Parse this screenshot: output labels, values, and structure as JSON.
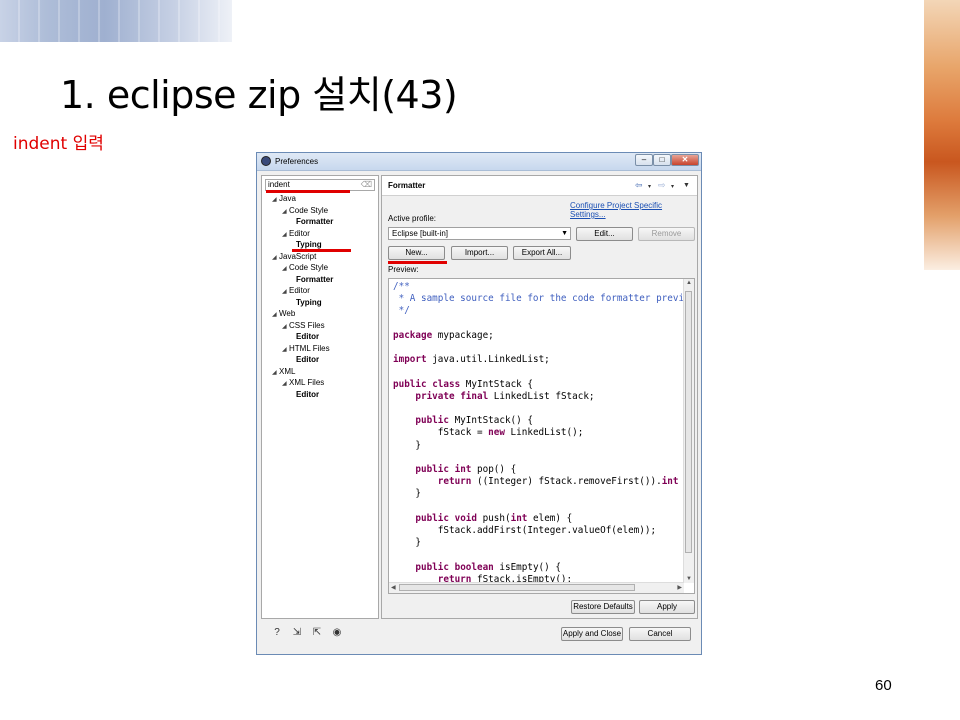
{
  "slide": {
    "title": "1. eclipse zip 설치(43)",
    "subtitle": "indent 입력",
    "page_number": "60"
  },
  "dialog": {
    "title": "Preferences",
    "filter_value": "indent",
    "tree": [
      {
        "label": "Java",
        "level": 0,
        "expanded": true
      },
      {
        "label": "Code Style",
        "level": 1,
        "expanded": true
      },
      {
        "label": "Formatter",
        "level": 2
      },
      {
        "label": "Editor",
        "level": 1,
        "expanded": true
      },
      {
        "label": "Typing",
        "level": 2
      },
      {
        "label": "JavaScript",
        "level": 0,
        "expanded": true
      },
      {
        "label": "Code Style",
        "level": 1,
        "expanded": true
      },
      {
        "label": "Formatter",
        "level": 2
      },
      {
        "label": "Editor",
        "level": 1,
        "expanded": true
      },
      {
        "label": "Typing",
        "level": 2
      },
      {
        "label": "Web",
        "level": 0,
        "expanded": true
      },
      {
        "label": "CSS Files",
        "level": 1,
        "expanded": true
      },
      {
        "label": "Editor",
        "level": 2
      },
      {
        "label": "HTML Files",
        "level": 1,
        "expanded": true
      },
      {
        "label": "Editor",
        "level": 2
      },
      {
        "label": "XML",
        "level": 0,
        "expanded": true
      },
      {
        "label": "XML Files",
        "level": 1,
        "expanded": true
      },
      {
        "label": "Editor",
        "level": 2
      }
    ],
    "page_heading": "Formatter",
    "configure_link": "Configure Project Specific Settings...",
    "active_profile_label": "Active profile:",
    "profile_value": "Eclipse [built-in]",
    "buttons": {
      "edit": "Edit...",
      "remove": "Remove",
      "new": "New...",
      "import": "Import...",
      "export_all": "Export All...",
      "restore_defaults": "Restore Defaults",
      "apply": "Apply",
      "apply_and_close": "Apply and Close",
      "cancel": "Cancel"
    },
    "preview_label": "Preview:",
    "preview_code": [
      "/**",
      " * A sample source file for the code formatter previ",
      " */",
      "",
      "package mypackage;",
      "",
      "import java.util.LinkedList;",
      "",
      "public class MyIntStack {",
      "    private final LinkedList fStack;",
      "",
      "    public MyIntStack() {",
      "        fStack = new LinkedList();",
      "    }",
      "",
      "    public int pop() {",
      "        return ((Integer) fStack.removeFirst()).int",
      "    }",
      "",
      "    public void push(int elem) {",
      "        fStack.addFirst(Integer.valueOf(elem));",
      "    }",
      "",
      "    public boolean isEmpty() {",
      "        return fStack.isEmpty();"
    ]
  }
}
